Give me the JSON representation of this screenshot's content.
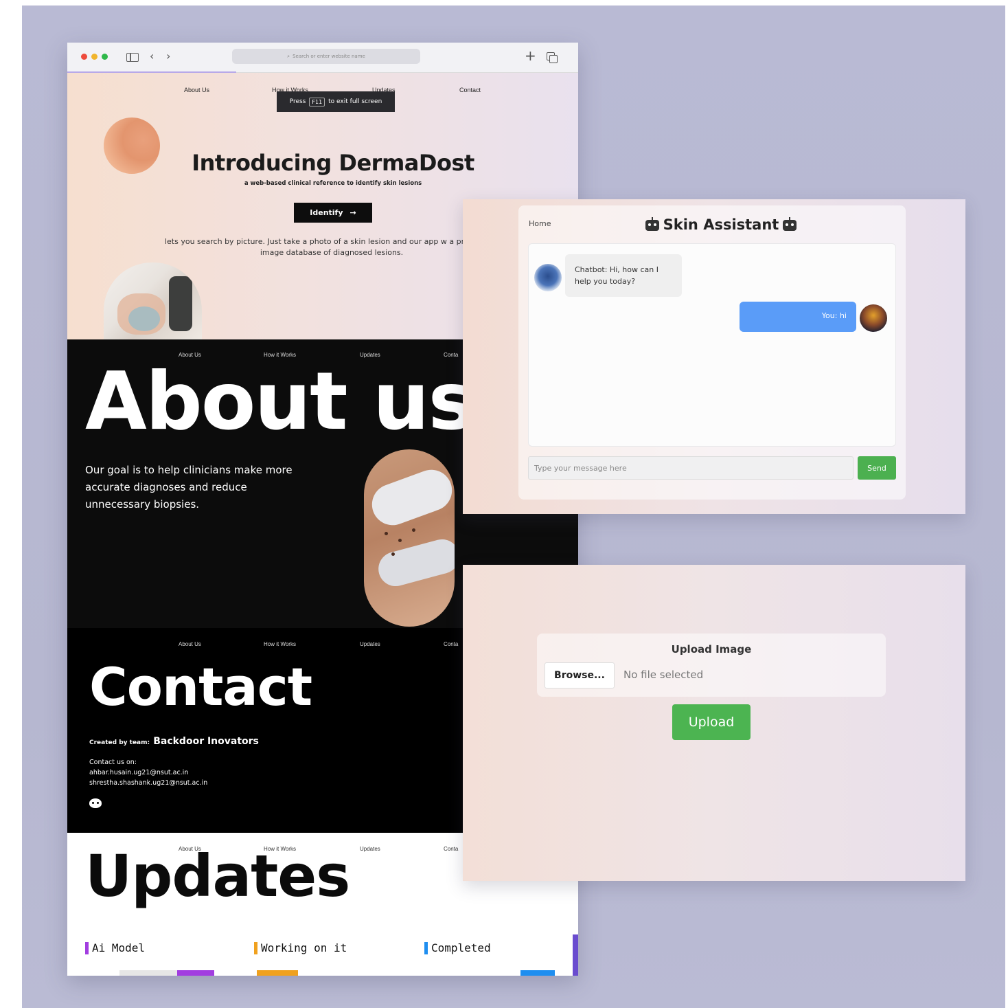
{
  "browser": {
    "address_placeholder": "Search or enter website name"
  },
  "nav": {
    "about": "About Us",
    "how": "How it Works",
    "updates": "Updates",
    "contact": "Contact",
    "contact_cut": "Conta"
  },
  "toast": {
    "press": "Press",
    "key": "F11",
    "suffix": "to exit full screen"
  },
  "hero": {
    "title": "Introducing DermaDost",
    "subtitle": "a web-based clinical reference to identify skin lesions",
    "identify_label": "Identify",
    "description": "lets you search by picture. Just take a photo of a skin lesion and our app w a proprietary image database of diagnosed lesions."
  },
  "about": {
    "title": "About us",
    "text": "Our goal is to help clinicians make more accurate diagnoses and reduce unnecessary biopsies."
  },
  "contact": {
    "title": "Contact",
    "team_label": "Created by team:",
    "team_name": "Backdoor Inovators",
    "contact_label": "Contact us on:",
    "email1": "ahbar.husain.ug21@nsut.ac.in",
    "email2": "shrestha.shashank.ug21@nsut.ac.in"
  },
  "updates": {
    "title": "Updates",
    "categories": [
      "Ai Model",
      "Working on it",
      "Completed"
    ]
  },
  "chat": {
    "home": "Home",
    "title": "Skin Assistant",
    "bot_message": "Chatbot: Hi, how can I help you today?",
    "user_message": "You: hi",
    "input_placeholder": "Type your message here",
    "send_label": "Send"
  },
  "upload": {
    "title": "Upload Image",
    "browse_label": "Browse...",
    "no_file": "No file selected",
    "upload_label": "Upload"
  },
  "colors": {
    "send_green": "#4cb050",
    "user_bubble": "#5a9cf8",
    "ai_model": "#a23de0",
    "working": "#f0a11e",
    "completed": "#1f8ef0"
  }
}
